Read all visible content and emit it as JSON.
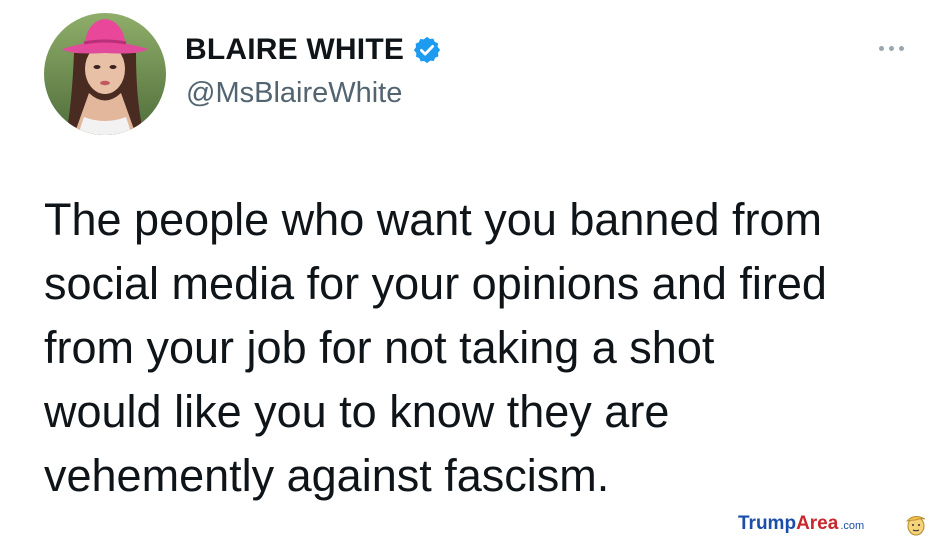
{
  "tweet": {
    "display_name": "BLAIRE WHITE",
    "handle": "@MsBlaireWhite",
    "text": "The people who want you banned from\nsocial media for your opinions and fired\nfrom your job for not taking a shot\nwould like you to know they are\nvehemently against fascism.",
    "verified": true,
    "verified_color": "#1d9bf0"
  },
  "watermark": {
    "part1": "Trump",
    "part2": "Area",
    "part3": ".com",
    "color_primary": "#1a4ea8",
    "color_accent": "#c8272d"
  },
  "icons": {
    "more": "more-horizontal-icon",
    "verified": "verified-badge-icon",
    "watermark_logo": "trump-face-logo-icon"
  }
}
